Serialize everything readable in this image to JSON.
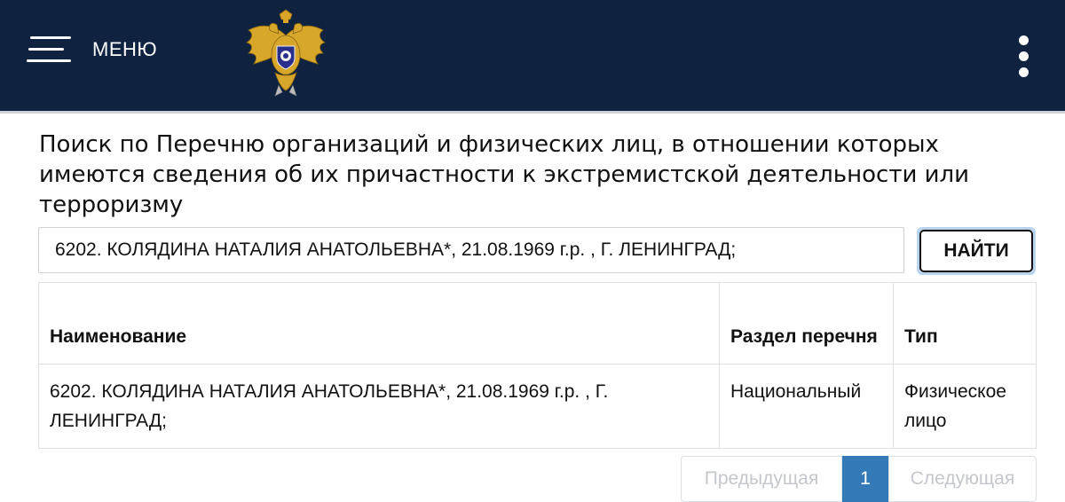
{
  "header": {
    "menu_label": "МЕНЮ",
    "logo_icon": "double-headed-eagle-emblem",
    "more_icon": "kebab-menu-icon",
    "colors": {
      "background": "#0f2340",
      "foreground": "#ffffff"
    }
  },
  "page": {
    "title": "Поиск по Перечню организаций и физических лиц, в отношении которых имеются сведения об их причастности к экстремистской деятельности или терроризму"
  },
  "search": {
    "value": "6202. КОЛЯДИНА НАТАЛИЯ АНАТОЛЬЕВНА*, 21.08.1969 г.р. , Г. ЛЕНИНГРАД;",
    "button_label": "НАЙТИ"
  },
  "table": {
    "headers": [
      "Наименование",
      "Раздел перечня",
      "Тип"
    ],
    "rows": [
      {
        "name": "6202. КОЛЯДИНА НАТАЛИЯ АНАТОЛЬЕВНА*, 21.08.1969 г.р. , Г. ЛЕНИНГРАД;",
        "section": "Национальный",
        "type": "Физическое лицо"
      }
    ]
  },
  "pagination": {
    "prev_label": "Предыдущая",
    "current_page": "1",
    "next_label": "Следующая",
    "active_color": "#337ab7"
  }
}
